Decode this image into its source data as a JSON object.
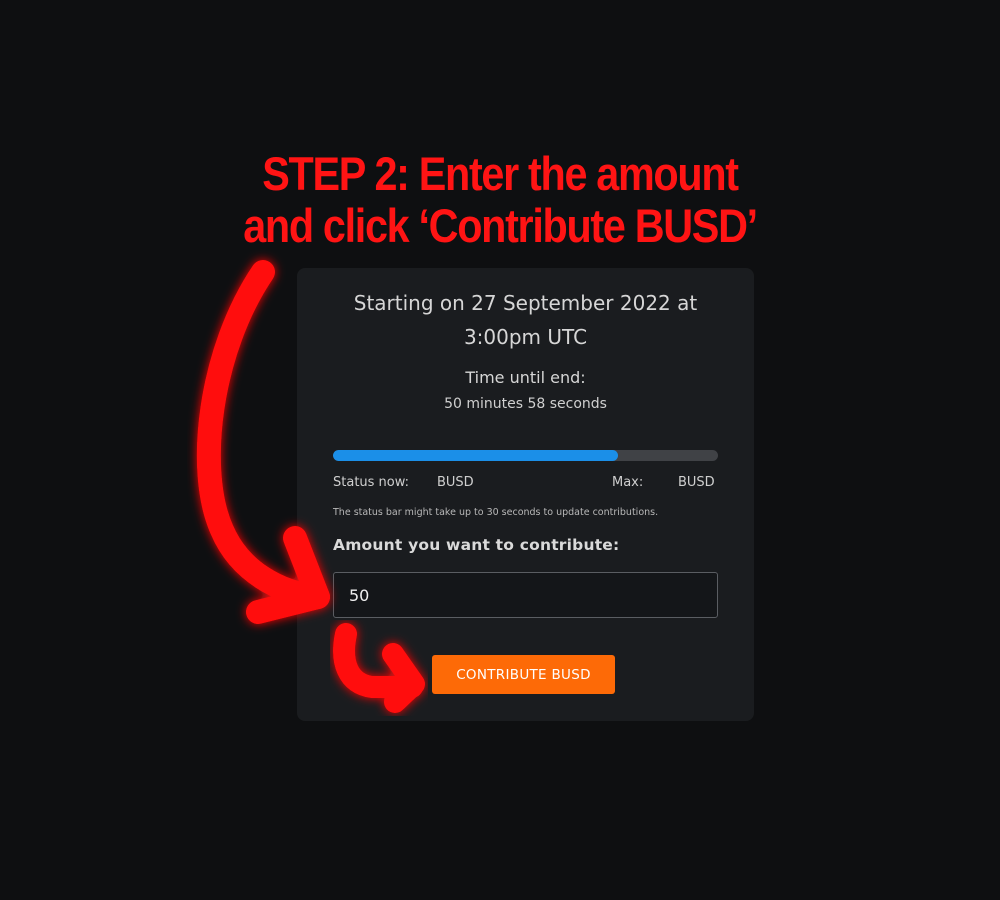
{
  "instruction": {
    "line1": "STEP 2: Enter the amount",
    "line2": "and click ‘Contribute BUSD’",
    "color": "#ff1414"
  },
  "sale": {
    "start_line1": "Starting on 27 September 2022 at",
    "start_line2": "3:00pm UTC",
    "time_label": "Time until end:",
    "time_value": "50 minutes 58 seconds",
    "progress_fraction": 0.74,
    "status_label": "Status now:",
    "status_currency": "BUSD",
    "max_label": "Max:",
    "max_currency": "BUSD",
    "status_note": "The status bar might take up to 30 seconds to update contributions."
  },
  "form": {
    "amount_label": "Amount you want to contribute:",
    "amount_value": "50",
    "button_label": "CONTRIBUTE BUSD"
  },
  "colors": {
    "background": "#0e0f11",
    "card": "#1a1c1f",
    "progress": "#1b8fe8",
    "button": "#fd6a07"
  },
  "icons": [
    "curved-arrow-icon",
    "hook-arrow-icon"
  ]
}
